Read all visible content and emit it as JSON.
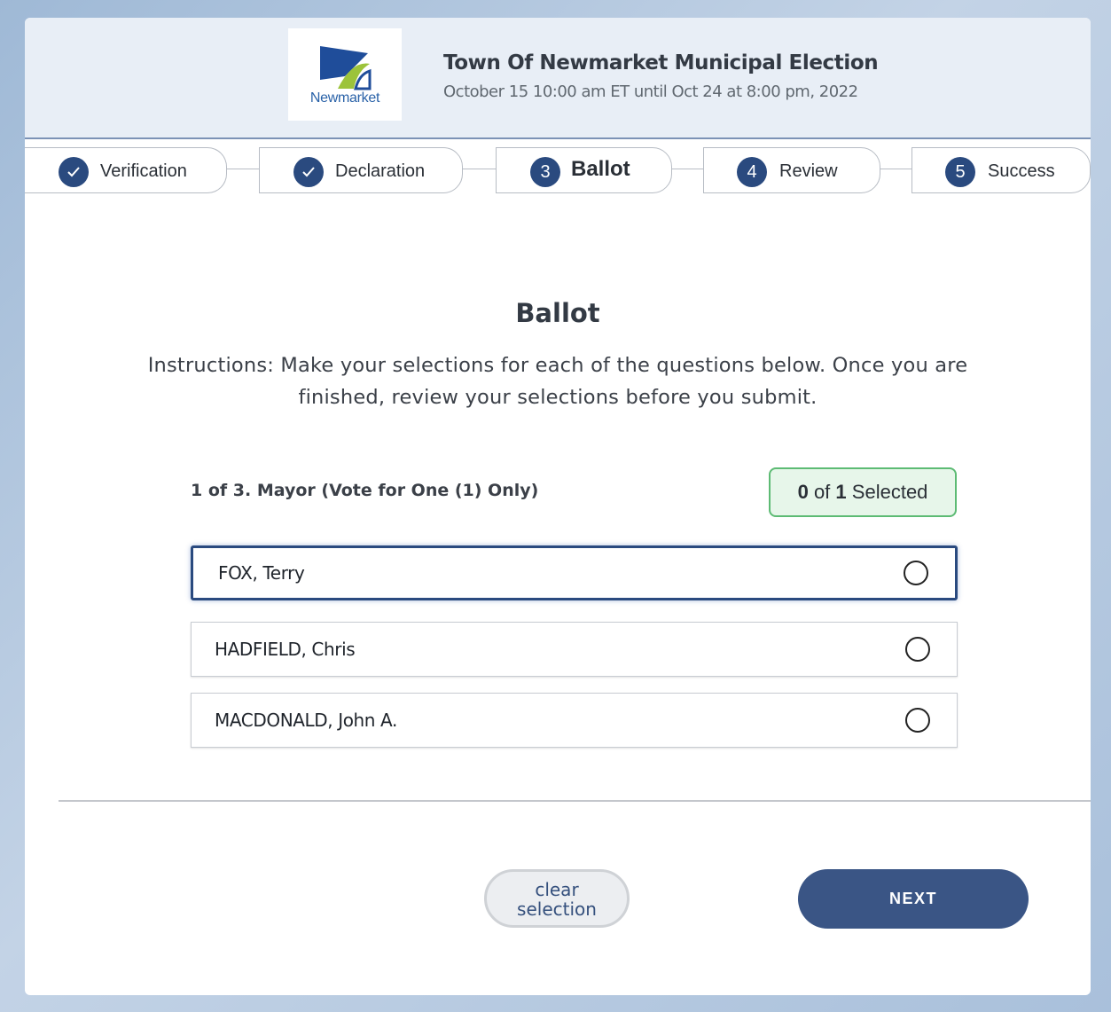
{
  "header": {
    "logo_text": "Newmarket",
    "title": "Town Of Newmarket Municipal Election",
    "subtitle": "October 15 10:00 am ET until Oct 24 at 8:00 pm, 2022"
  },
  "steps": [
    {
      "label": "Verification",
      "state": "complete",
      "icon": "check-icon"
    },
    {
      "label": "Declaration",
      "state": "complete",
      "icon": "check-icon"
    },
    {
      "label": "Ballot",
      "number": "3",
      "state": "active"
    },
    {
      "label": "Review",
      "number": "4",
      "state": "upcoming"
    },
    {
      "label": "Success",
      "number": "5",
      "state": "upcoming"
    }
  ],
  "main": {
    "heading": "Ballot",
    "instructions": "Instructions: Make your selections for each of the questions below. Once you are finished, review your selections before you submit.",
    "question": "1 of 3. Mayor (Vote for One (1) Only)",
    "selected_count": "0",
    "selected_of": "of",
    "selected_max": "1",
    "selected_suffix": "Selected",
    "options": [
      {
        "label": "FOX, Terry"
      },
      {
        "label": "HADFIELD, Chris"
      },
      {
        "label": "MACDONALD, John A."
      }
    ]
  },
  "actions": {
    "clear_label_line1": "clear",
    "clear_label_line2": "selection",
    "next_label": "NEXT"
  },
  "colors": {
    "primary": "#2a4a7f",
    "button": "#3a5585",
    "success_border": "#5dbb74",
    "success_bg": "#e7f6ea"
  }
}
